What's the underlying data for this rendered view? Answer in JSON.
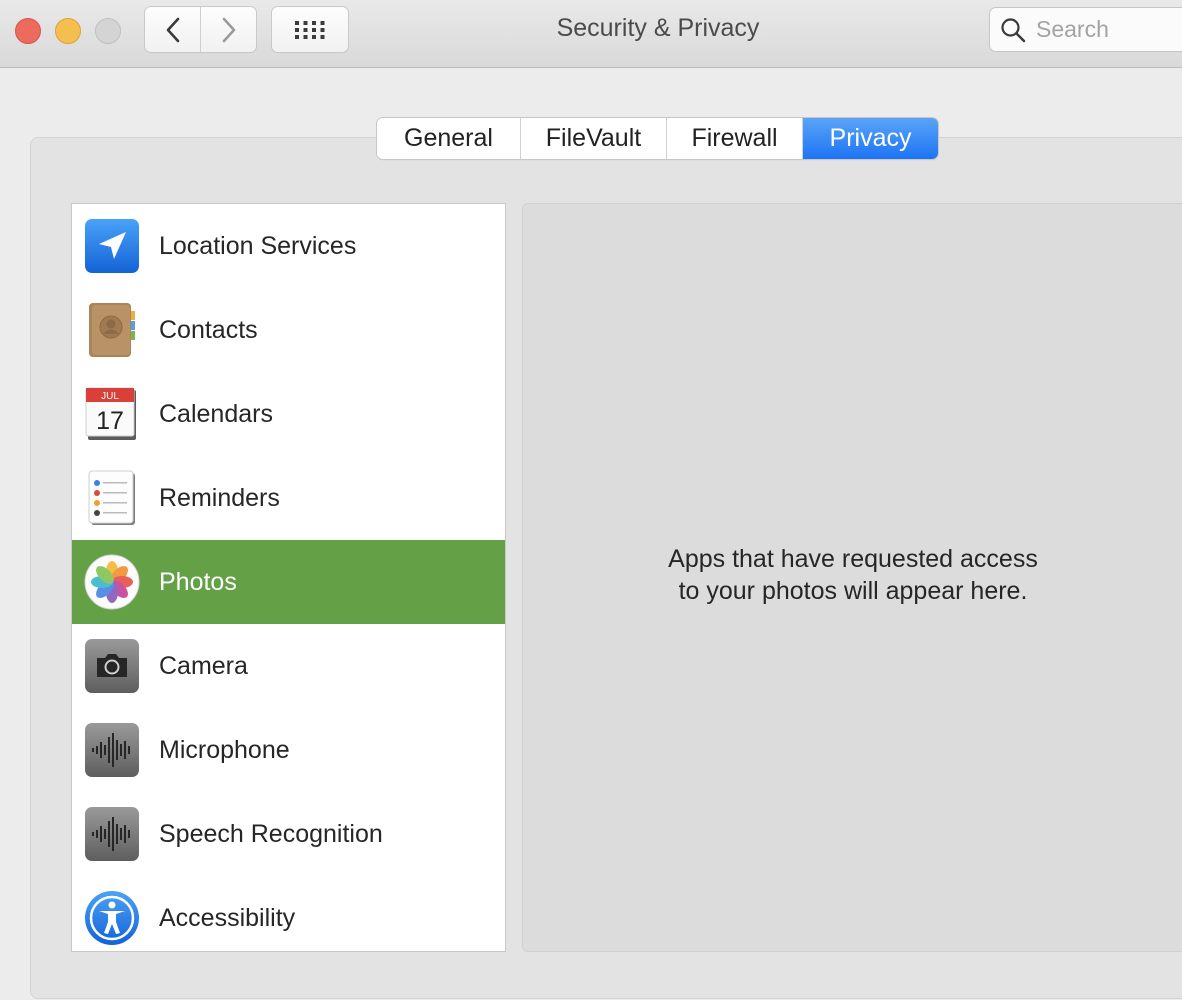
{
  "window": {
    "title": "Security & Privacy",
    "search_placeholder": "Search"
  },
  "toolbar": {
    "back_icon": "chevron-left-icon",
    "forward_icon": "chevron-right-icon",
    "show_all_icon": "grid-icon"
  },
  "tabs": [
    {
      "label": "General",
      "active": false
    },
    {
      "label": "FileVault",
      "active": false
    },
    {
      "label": "Firewall",
      "active": false
    },
    {
      "label": "Privacy",
      "active": true
    }
  ],
  "privacy_list": [
    {
      "label": "Location Services",
      "icon": "location-arrow-icon"
    },
    {
      "label": "Contacts",
      "icon": "contacts-book-icon"
    },
    {
      "label": "Calendars",
      "icon": "calendar-icon",
      "icon_text": {
        "month": "JUL",
        "day": "17"
      }
    },
    {
      "label": "Reminders",
      "icon": "reminders-list-icon"
    },
    {
      "label": "Photos",
      "icon": "photos-flower-icon",
      "selected": true
    },
    {
      "label": "Camera",
      "icon": "camera-icon"
    },
    {
      "label": "Microphone",
      "icon": "microphone-waveform-icon"
    },
    {
      "label": "Speech Recognition",
      "icon": "speech-waveform-icon"
    },
    {
      "label": "Accessibility",
      "icon": "accessibility-person-icon"
    }
  ],
  "detail": {
    "message_line1": "Apps that have requested access",
    "message_line2": "to your photos will appear here."
  },
  "colors": {
    "selected_row": "#63a046",
    "active_tab": "#1d74f5",
    "close": "#ed6a5e",
    "minimize": "#f5bf4f"
  }
}
